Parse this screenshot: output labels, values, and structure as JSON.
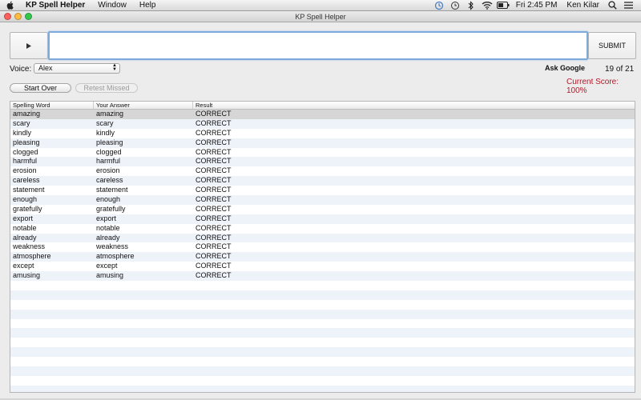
{
  "menubar": {
    "app_name": "KP Spell Helper",
    "menus": [
      "Window",
      "Help"
    ],
    "clock": "Fri 2:45 PM",
    "user": "Ken Kilar"
  },
  "window": {
    "title": "KP Spell Helper"
  },
  "controls": {
    "answer_value": "",
    "submit_label": "SUBMIT",
    "voice_label": "Voice:",
    "voice_selected": "Alex",
    "ask_google_label": "Ask Google",
    "progress": "19 of 21",
    "score": "Current Score: 100%",
    "start_over_label": "Start Over",
    "retest_missed_label": "Retest Missed"
  },
  "table": {
    "columns": [
      "Spelling Word",
      "Your Answer",
      "Result"
    ],
    "rows": [
      [
        "amazing",
        "amazing",
        "CORRECT"
      ],
      [
        "scary",
        "scary",
        "CORRECT"
      ],
      [
        "kindly",
        "kindly",
        "CORRECT"
      ],
      [
        "pleasing",
        "pleasing",
        "CORRECT"
      ],
      [
        "clogged",
        "clogged",
        "CORRECT"
      ],
      [
        "harmful",
        "harmful",
        "CORRECT"
      ],
      [
        "erosion",
        "erosion",
        "CORRECT"
      ],
      [
        "careless",
        "careless",
        "CORRECT"
      ],
      [
        "statement",
        "statement",
        "CORRECT"
      ],
      [
        "enough",
        "enough",
        "CORRECT"
      ],
      [
        "gratefully",
        "gratefully",
        "CORRECT"
      ],
      [
        "export",
        "export",
        "CORRECT"
      ],
      [
        "notable",
        "notable",
        "CORRECT"
      ],
      [
        "already",
        "already",
        "CORRECT"
      ],
      [
        "weakness",
        "weakness",
        "CORRECT"
      ],
      [
        "atmosphere",
        "atmosphere",
        "CORRECT"
      ],
      [
        "except",
        "except",
        "CORRECT"
      ],
      [
        "amusing",
        "amusing",
        "CORRECT"
      ]
    ],
    "selected_row": 0
  },
  "colors": {
    "score_red": "#b01a2a",
    "input_focus": "#7ea9db",
    "row_alt": "#eef3fa"
  },
  "icons": {
    "apple": "apple-icon",
    "play": "play-icon"
  }
}
